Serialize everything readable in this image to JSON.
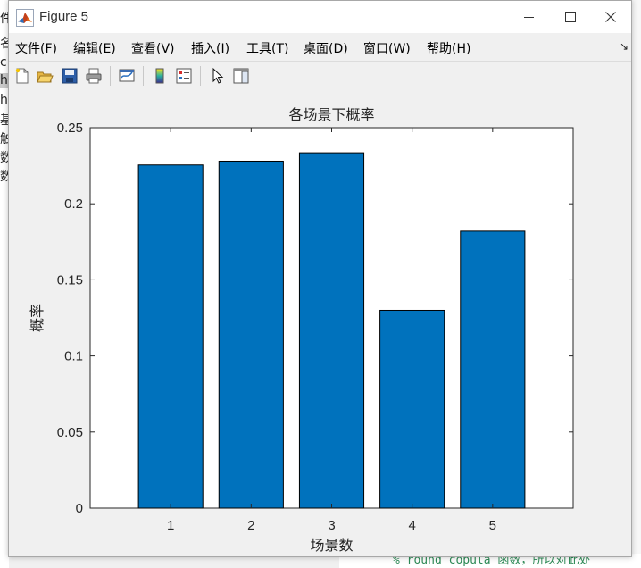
{
  "window": {
    "title": "Figure 5"
  },
  "menu": [
    "文件(F)",
    "编辑(E)",
    "查看(V)",
    "插入(I)",
    "工具(T)",
    "桌面(D)",
    "窗口(W)",
    "帮助(H)"
  ],
  "toolbar": {
    "icons": [
      "new-figure-icon",
      "open-file-icon",
      "save-icon",
      "print-icon",
      "link-plot-icon",
      "insert-colorbar-icon",
      "insert-legend-icon",
      "edit-plot-icon",
      "property-inspector-icon"
    ]
  },
  "background_app": {
    "left_lines": [
      "件",
      "名",
      "c",
      "ha",
      "hi",
      "基",
      "触",
      "数",
      "数"
    ],
    "bottom_code": "% round copula 函数，所以对此处"
  },
  "chart_data": {
    "type": "bar",
    "title": "各场景下概率",
    "xlabel": "场景数",
    "ylabel": "概率",
    "categories": [
      "1",
      "2",
      "3",
      "4",
      "5"
    ],
    "values": [
      0.2255,
      0.228,
      0.2335,
      0.13,
      0.182
    ],
    "xlim": [
      0,
      6
    ],
    "ylim": [
      0,
      0.25
    ],
    "yticks": [
      0,
      0.05,
      0.1,
      0.15,
      0.2,
      0.25
    ],
    "ytick_labels": [
      "0",
      "0.05",
      "0.1",
      "0.15",
      "0.2",
      "0.25"
    ],
    "bar_color": "#0072BD",
    "grid": false
  }
}
